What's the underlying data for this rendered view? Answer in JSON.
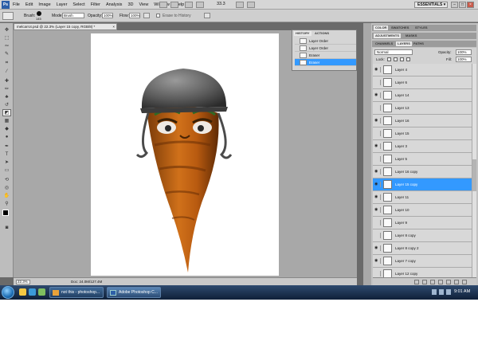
{
  "menu": [
    "File",
    "Edit",
    "Image",
    "Layer",
    "Select",
    "Filter",
    "Analysis",
    "3D",
    "View",
    "Window",
    "Help"
  ],
  "title_bar": {
    "zoom": "33.3",
    "workspace": "ESSENTIALS",
    "workspace_arrow": "▾",
    "minimize": "–",
    "maximize": "□",
    "close": "×"
  },
  "options": {
    "brush_label": "Brush:",
    "brush_size": "145",
    "mode_label": "Mode:",
    "mode_value": "Brush",
    "opacity_label": "Opacity:",
    "opacity_value": "100%",
    "flow_label": "Flow:",
    "flow_value": "100%",
    "erase_history": "Erase to History"
  },
  "document": {
    "tab_title": "melcarrot.psd @ 22.3% (Layer 15 copy, RGB/8) *",
    "tab_close": "×",
    "zoom": "22.3%",
    "doc_size": "Doc: 24.0M/127.4M"
  },
  "history": {
    "tabs": [
      "HISTORY",
      "ACTIONS"
    ],
    "rows": [
      {
        "label": "Layer Order",
        "selected": false
      },
      {
        "label": "Layer Order",
        "selected": false
      },
      {
        "label": "Eraser",
        "selected": false
      },
      {
        "label": "Eraser",
        "selected": true
      }
    ]
  },
  "dock": {
    "tabs_top": [
      "COLOR",
      "SWATCHES",
      "STYLES"
    ],
    "tabs_mid": [
      "ADJUSTMENTS",
      "MASKS"
    ],
    "tabs_layers": [
      "CHANNELS",
      "LAYERS",
      "PATHS"
    ],
    "blend_mode": "Normal",
    "opacity_label": "Opacity:",
    "opacity_value": "100%",
    "lock_label": "Lock:",
    "fill_label": "Fill:",
    "fill_value": "100%"
  },
  "layers": [
    {
      "name": "Layer 4",
      "visible": true,
      "selected": false
    },
    {
      "name": "Layer 6",
      "visible": false,
      "selected": false
    },
    {
      "name": "Layer 14",
      "visible": true,
      "selected": false
    },
    {
      "name": "Layer 13",
      "visible": false,
      "selected": false
    },
    {
      "name": "Layer 16",
      "visible": true,
      "selected": false
    },
    {
      "name": "Layer 15",
      "visible": false,
      "selected": false
    },
    {
      "name": "Layer 3",
      "visible": true,
      "selected": false
    },
    {
      "name": "Layer 5",
      "visible": false,
      "selected": false
    },
    {
      "name": "Layer 16 copy",
      "visible": true,
      "selected": false
    },
    {
      "name": "Layer 15 copy",
      "visible": true,
      "selected": true
    },
    {
      "name": "Layer 11",
      "visible": true,
      "selected": false
    },
    {
      "name": "Layer 10",
      "visible": true,
      "selected": false
    },
    {
      "name": "Layer 9",
      "visible": false,
      "selected": false
    },
    {
      "name": "Layer 8 copy",
      "visible": false,
      "selected": false
    },
    {
      "name": "Layer 8 copy 2",
      "visible": true,
      "selected": false
    },
    {
      "name": "Layer 7 copy",
      "visible": true,
      "selected": false
    },
    {
      "name": "Layer 12 copy",
      "visible": false,
      "selected": false
    }
  ],
  "taskbar": {
    "buttons": [
      {
        "label": "not this - photoshop..."
      },
      {
        "label": "Adobe Photoshop C..."
      }
    ],
    "clock": "9:01 AM"
  }
}
